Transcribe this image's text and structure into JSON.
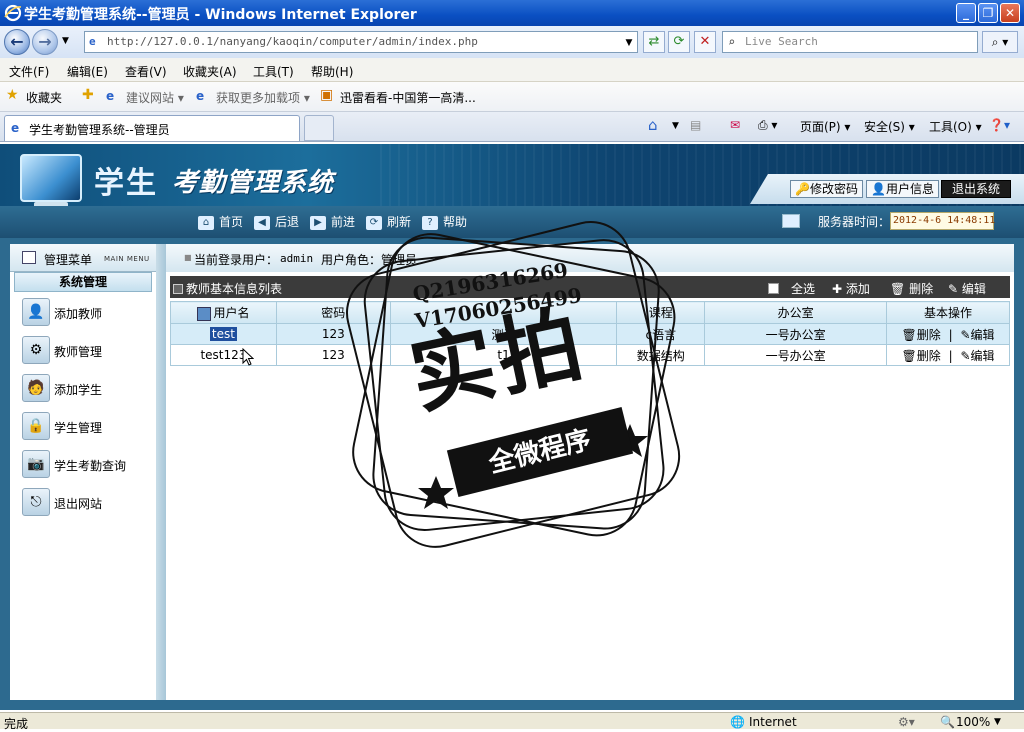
{
  "browser": {
    "window_title": "学生考勤管理系统--管理员 - Windows Internet Explorer",
    "url": "http://127.0.0.1/nanyang/kaoqin/computer/admin/index.php",
    "search_placeholder": "Live Search",
    "menu": [
      "文件(F)",
      "编辑(E)",
      "查看(V)",
      "收藏夹(A)",
      "工具(T)",
      "帮助(H)"
    ],
    "favorites": {
      "label": "收藏夹",
      "items": [
        "建议网站 ▾",
        "获取更多加载项 ▾",
        "迅雷看看-中国第一高清..."
      ]
    },
    "tab_title": "学生考勤管理系统--管理员",
    "command_bar": [
      "页面(P) ▾",
      "安全(S) ▾",
      "工具(O) ▾"
    ],
    "status": {
      "left": "完成",
      "zone": "Internet",
      "zoom": "100%"
    }
  },
  "app": {
    "title_part1": "学生",
    "title_part2": "考勤管理系统",
    "top_buttons": {
      "change_password": "修改密码",
      "user_info": "用户信息",
      "logout": "退出系统"
    },
    "toolbar": {
      "home": "首页",
      "back": "后退",
      "forward": "前进",
      "refresh": "刷新",
      "help": "帮助",
      "server_time_label": "服务器时间：",
      "server_time": "2012-4-6 14:48:11"
    },
    "sidebar": {
      "title": "管理菜单",
      "subtitle": "MAIN MENU",
      "section": "系统管理",
      "items": [
        "添加教师",
        "教师管理",
        "添加学生",
        "学生管理",
        "学生考勤查询",
        "退出网站"
      ]
    },
    "content_head": {
      "current_user_label": "当前登录用户：",
      "current_user": "admin",
      "role_label": "用户角色：",
      "role": "管理员"
    },
    "panel": {
      "title": "教师基本信息列表",
      "select_all": "全选",
      "add": "添加",
      "delete": "删除",
      "edit": "编辑"
    },
    "table": {
      "headers": [
        "用户名",
        "密码",
        "",
        "课程",
        "办公室",
        "基本操作"
      ],
      "rows": [
        {
          "username": "test",
          "password": "123",
          "name": "测试",
          "course": "c语言",
          "office": "一号办公室",
          "op_delete": "删除",
          "op_sep": "|",
          "op_edit": "编辑"
        },
        {
          "username": "test123",
          "password": "123",
          "name": "t1",
          "course": "数据结构",
          "office": "一号办公室",
          "op_delete": "删除",
          "op_sep": "|",
          "op_edit": "编辑"
        }
      ]
    }
  },
  "watermark": {
    "qq": "Q2196316269",
    "v": "V17060256499",
    "big": "实拍",
    "banner": "全微程序"
  }
}
